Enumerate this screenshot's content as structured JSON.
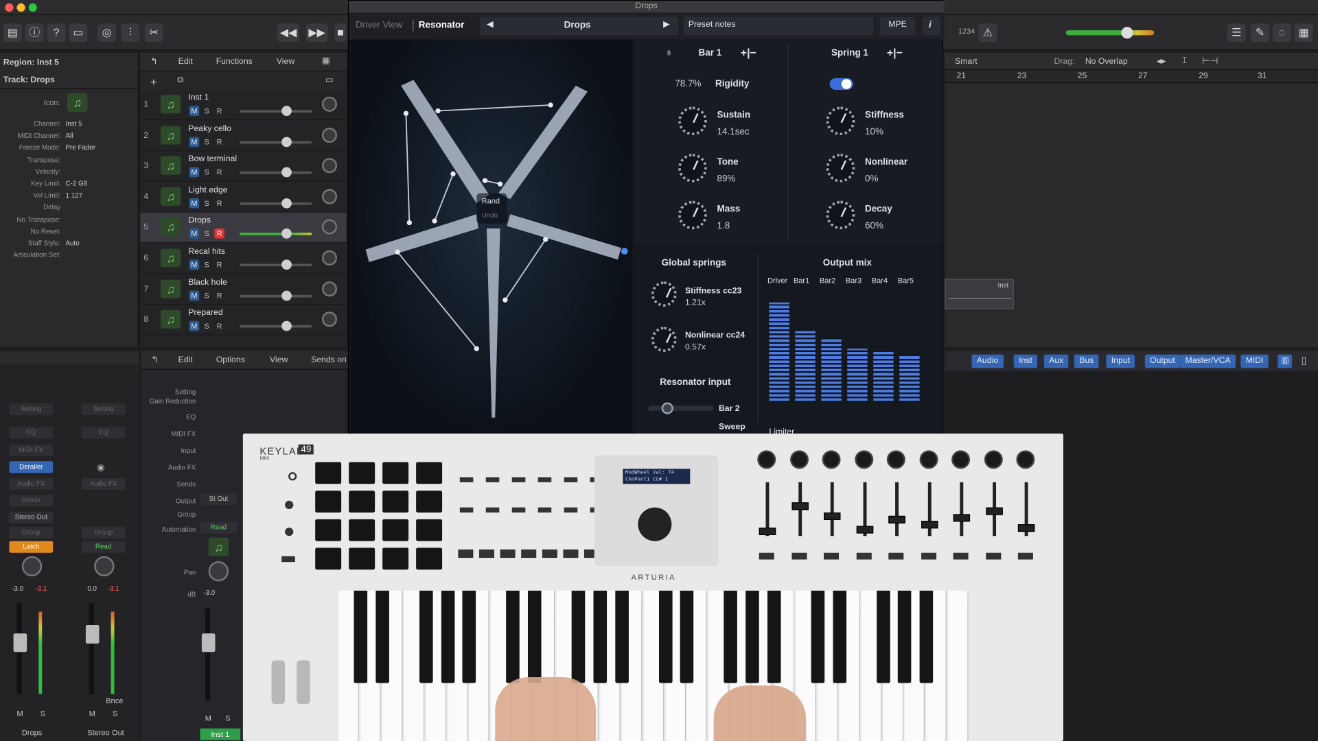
{
  "window": {
    "title": "Drops"
  },
  "inspector": {
    "region": "Region: Inst 5",
    "track": "Track:  Drops",
    "icon_label": "Icon:",
    "rows": [
      {
        "label": "Channel:",
        "value": "Inst 5"
      },
      {
        "label": "MIDI Channel:",
        "value": "All"
      },
      {
        "label": "Freeze Mode:",
        "value": "Pre Fader"
      },
      {
        "label": "Transpose:",
        "value": ""
      },
      {
        "label": "Velocity:",
        "value": ""
      },
      {
        "label": "Key Limit:",
        "value": "C-2  G8"
      },
      {
        "label": "Vel Limit:",
        "value": "1  127"
      },
      {
        "label": "Delay",
        "value": ""
      },
      {
        "label": "No Transpose:",
        "value": ""
      },
      {
        "label": "No Reset:",
        "value": ""
      },
      {
        "label": "Staff Style:",
        "value": "Auto"
      },
      {
        "label": "Articulation Set:",
        "value": ""
      }
    ]
  },
  "tracks_header": {
    "edit": "Edit",
    "functions": "Functions",
    "view": "View"
  },
  "tracks": [
    {
      "num": "1",
      "name": "Inst 1"
    },
    {
      "num": "2",
      "name": "Peaky cello"
    },
    {
      "num": "3",
      "name": "Bow terminal"
    },
    {
      "num": "4",
      "name": "Light edge"
    },
    {
      "num": "5",
      "name": "Drops"
    },
    {
      "num": "6",
      "name": "Recal hits"
    },
    {
      "num": "7",
      "name": "Black hole"
    },
    {
      "num": "8",
      "name": "Prepared"
    }
  ],
  "msr": {
    "m": "M",
    "s": "S",
    "r": "R"
  },
  "plugin": {
    "driver_view": "Driver View",
    "resonator": "Resonator",
    "preset": "Drops",
    "preset_notes": "Preset notes",
    "mpe": "MPE",
    "info": "i",
    "rand": "Rand",
    "undo": "Undo",
    "bar1": "Bar 1",
    "spring1": "Spring 1",
    "plusminus": "+|−",
    "rigidity_val": "78.7%",
    "rigidity": "Rigidity",
    "sustain": "Sustain",
    "sustain_val": "14.1sec",
    "tone": "Tone",
    "tone_val": "89%",
    "mass": "Mass",
    "mass_val": "1.8",
    "stiffness": "Stiffness",
    "stiffness_val": "10%",
    "nonlinear": "Nonlinear",
    "nonlinear_val": "0%",
    "decay": "Decay",
    "decay_val": "60%",
    "global_springs": "Global springs",
    "stiffness_cc": "Stiffness cc23",
    "stiffness_cc_val": "1.21x",
    "nonlinear_cc": "Nonlinear cc24",
    "nonlinear_cc_val": "0.57x",
    "resonator_input": "Resonator input",
    "bar2": "Bar 2",
    "sweep": "Sweep",
    "limiter": "Limiter",
    "output_mix": "Output mix",
    "mix_labels": [
      "Driver",
      "Bar1",
      "Bar2",
      "Bar3",
      "Bar4",
      "Bar5"
    ],
    "mix_levels": [
      0.9,
      0.65,
      0.58,
      0.48,
      0.45,
      0.42
    ]
  },
  "toolbar": {
    "lcd": "1234"
  },
  "arrange": {
    "tool": "Smart",
    "drag_label": "Drag:",
    "drag_value": "No Overlap",
    "ruler": [
      "21",
      "23",
      "25",
      "27",
      "29",
      "31"
    ],
    "region_label": "Inst"
  },
  "mixer_tabs": [
    "Audio",
    "Inst",
    "Aux",
    "Bus",
    "Input",
    "Output",
    "Master/VCA",
    "MIDI"
  ],
  "mixer_header": {
    "edit": "Edit",
    "options": "Options",
    "view": "View",
    "sends": "Sends on"
  },
  "mixer_labels": [
    "Setting",
    "Gain Reduction",
    "EQ",
    "MIDI FX",
    "Input",
    "Audio FX",
    "Sends",
    "Output",
    "Group",
    "Automation",
    "Pan",
    "dB"
  ],
  "channel1": {
    "setting": "Setting",
    "eq": "EQ",
    "midifx": "MIDI FX",
    "derailer": "Derailer",
    "audiofx": "Audio FX",
    "sends": "Sends",
    "output": "Stereo Out",
    "group": "Group",
    "auto": "Latch",
    "db1": "-3.0",
    "db2": "-3.1",
    "name": "Drops",
    "m": "M",
    "s": "S"
  },
  "channel2": {
    "setting": "Setting",
    "eq": "EQ",
    "audiofx": "Audio FX",
    "group": "Group",
    "auto": "Read",
    "db1": "0.0",
    "db2": "-3.1",
    "bnce": "Bnce",
    "name": "Stereo Out",
    "m": "M",
    "s": "S"
  },
  "channel3": {
    "output": "St Out",
    "auto": "Read",
    "db": "-3.0",
    "name": "Inst 1",
    "m": "M",
    "s": "S"
  },
  "keyboard": {
    "brand": "KEYLAB",
    "model": "49",
    "sub": "MkII",
    "maker": "ARTURIA",
    "lcd1": "ModWheel Val: 74",
    "lcd2": "ChnPart1  CC# 1"
  }
}
